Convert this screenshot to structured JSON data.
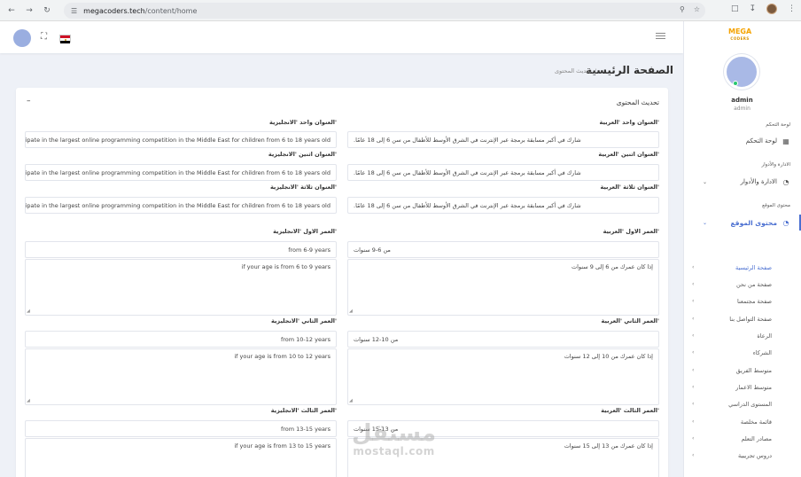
{
  "browser": {
    "url_host": "megacoders.tech",
    "url_path": "/content/home"
  },
  "sidebar": {
    "logo_top": "MEGA",
    "logo_bottom": "CODERS",
    "user_name": "admin",
    "user_role": "admin",
    "section_dashboard": "لوحة التحكم",
    "item_dashboard": "لوحة التحكم",
    "section_roles": "الادارة والأدوار",
    "item_roles": "الادارة والأدوار",
    "section_content": "محتوى الموقع",
    "item_content": "محتوى الموقع",
    "sub_items": [
      "صفحة الرئيسية",
      "صفحة من نحن",
      "صفحة مجتمعنا",
      "صفحة التواصل بنا",
      "الرعاة",
      "الشركاء",
      "متوسط الفريق",
      "متوسط الاعمار",
      "المستوى الدراسي",
      "قائمة مخلصة",
      "مصادر التعلم",
      "دروس تجريبية"
    ]
  },
  "header": {
    "page_title": "الصفحة الرئيسية",
    "breadcrumb_current": "تحديث المحتوى",
    "breadcrumb_sep": "/"
  },
  "card": {
    "title": "تحديث المحتوى",
    "collapse": "–"
  },
  "fields": {
    "title1_ar_label": "العنوان واحد 'العربية'",
    "title1_en_label": "العنوان واحد 'الانجليزية'",
    "title1_ar_value": "شارك في أكبر مسابقة برمجة عبر الإنترنت في الشرق الأوسط للأطفال من سن 6 إلى 18 عامًا.",
    "title1_en_value": "cipate in the largest online programming competition in the Middle East for children from 6 to 18 years old",
    "title2_ar_label": "العنوان اثنين 'العربية'",
    "title2_en_label": "العنوان اثنين 'الانجليزية'",
    "title2_ar_value": "شارك في أكبر مسابقة برمجة عبر الإنترنت في الشرق الأوسط للأطفال من سن 6 إلى 18 عامًا.",
    "title2_en_value": "cipate in the largest online programming competition in the Middle East for children from 6 to 18 years old",
    "title3_ar_label": "العنوان ثلاثة 'العربية'",
    "title3_en_label": "العنوان ثلاثة 'الانجليزية'",
    "title3_ar_value": "شارك في أكبر مسابقة برمجة عبر الإنترنت في الشرق الأوسط للأطفال من سن 6 إلى 18 عامًا.",
    "title3_en_value": "cipate in the largest online programming competition in the Middle East for children from 6 to 18 years old",
    "age1_ar_label": "العمر الاول 'العربية'",
    "age1_en_label": "العمر الاول 'الانجليزية'",
    "age1_ar_value": "من 6-9 سنوات",
    "age1_en_value": "from 6-9 years",
    "age1_ar_desc": "إذا كان عمرك من 6 إلى 9 سنوات",
    "age1_en_desc": "if your age is from 6 to 9 years",
    "age2_ar_label": "العمر الثاني 'العربية'",
    "age2_en_label": "العمر الثاني 'الانجليزية'",
    "age2_ar_value": "من 10-12 سنوات",
    "age2_en_value": "from 10-12 years",
    "age2_ar_desc": "إذا كان عمرك من 10 إلى 12 سنوات",
    "age2_en_desc": "if your age is from 10 to 12 years",
    "age3_ar_label": "العمر الثالث 'العربية'",
    "age3_en_label": "العمر الثالث 'الانجليزية'",
    "age3_ar_value": "من 13-15 سنوات",
    "age3_en_value": "from 13-15 years",
    "age3_ar_desc": "إذا كان عمرك من 13 إلى 15 سنوات",
    "age3_en_desc": "if your age is from 13 to 15 years"
  },
  "watermark": {
    "arabic": "مستقل",
    "latin": "mostaql.com"
  }
}
